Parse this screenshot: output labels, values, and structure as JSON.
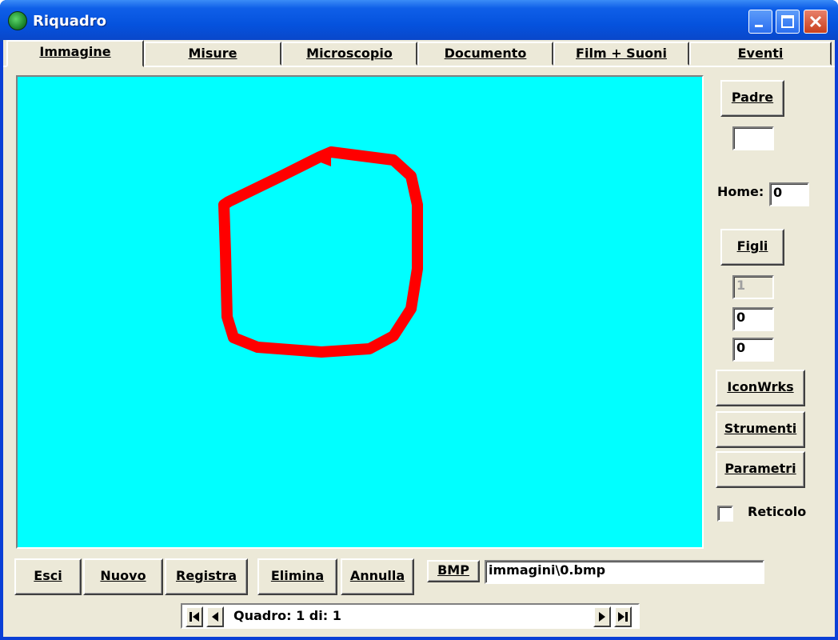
{
  "window": {
    "title": "Riquadro"
  },
  "tabs": [
    "Immagine",
    "Misure",
    "Microscopio",
    "Documento",
    "Film + Suoni",
    "Eventi"
  ],
  "side": {
    "padre_label": "Padre",
    "padre_value": "",
    "home_label": "Home:",
    "home_value": "0",
    "figli_label": "Figli",
    "figli_value_1": "1",
    "figli_value_2": "0",
    "figli_value_3": "0",
    "iconwrks_label": "IconWrks",
    "strumenti_label": "Strumenti",
    "parametri_label": "Parametri",
    "reticolo_label": "Reticolo",
    "reticolo_checked": false
  },
  "bottom": {
    "esci": "Esci",
    "nuovo": "Nuovo",
    "registra": "Registra",
    "elimina": "Elimina",
    "annulla": "Annulla",
    "bmp": "BMP",
    "path": "immagini\\0.bmp"
  },
  "nav": {
    "status": "Quadro: 1 di: 1"
  },
  "colors": {
    "canvas": "#00ffff",
    "shape": "#ff0000",
    "titlebar": "#0552dd",
    "face": "#ece9d8"
  },
  "icons": [
    "globe-app-icon",
    "minimize-icon",
    "maximize-icon",
    "close-icon",
    "first-record-icon",
    "prev-record-icon",
    "next-record-icon",
    "last-record-icon"
  ]
}
